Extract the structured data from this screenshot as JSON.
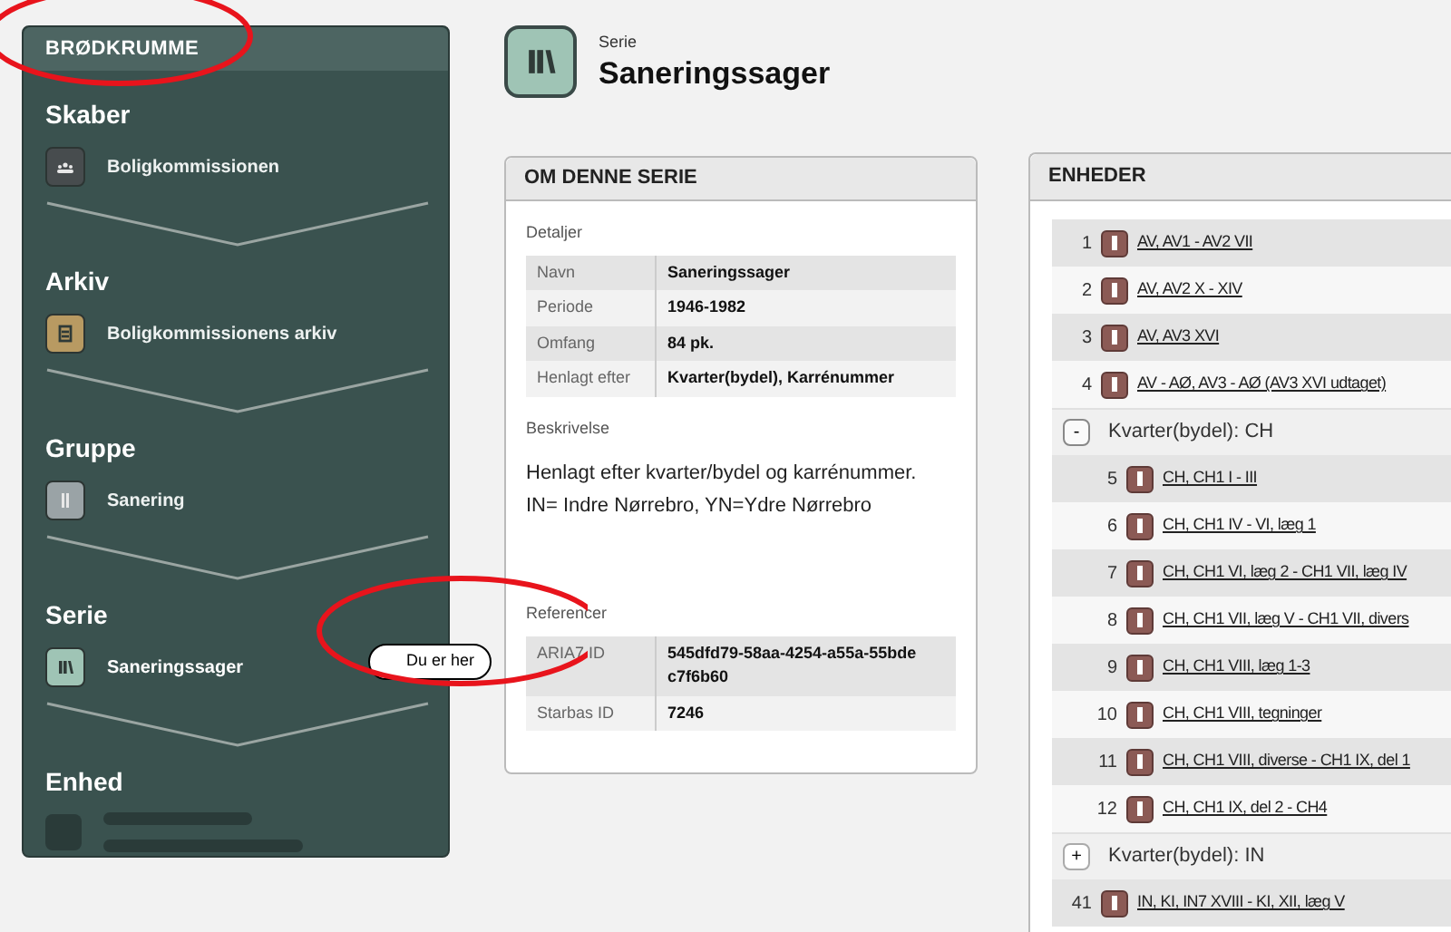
{
  "breadcrumb": {
    "title": "BRØDKRUMME",
    "levels": [
      {
        "kind": "creator",
        "label": "Skaber",
        "name": "Boligkommissionen",
        "current": false
      },
      {
        "kind": "archive",
        "label": "Arkiv",
        "name": "Boligkommissionens arkiv",
        "current": false
      },
      {
        "kind": "group",
        "label": "Gruppe",
        "name": "Sanering",
        "current": false
      },
      {
        "kind": "series",
        "label": "Serie",
        "name": "Saneringssager",
        "current": true
      },
      {
        "kind": "placeholder",
        "label": "Enhed",
        "current": false
      }
    ],
    "marker": "Du er her"
  },
  "header": {
    "kind": "series",
    "subtitle": "Serie",
    "title": "Saneringssager"
  },
  "about": {
    "title": "OM DENNE SERIE",
    "details_label": "Detaljer",
    "details": [
      {
        "label": "Navn",
        "value": "Saneringssager"
      },
      {
        "label": "Periode",
        "value": "1946-1982"
      },
      {
        "label": "Omfang",
        "value": "84 pk."
      },
      {
        "label": "Henlagt efter",
        "value": "Kvarter(bydel), Karrénummer"
      }
    ],
    "description_label": "Beskrivelse",
    "description": [
      "Henlagt efter kvarter/bydel og karrénummer.",
      "IN= Indre Nørrebro, YN=Ydre Nørrebro"
    ],
    "references_label": "Referencer",
    "references": [
      {
        "label": "ARIA7 ID",
        "value": "545dfd79-58aa-4254-a55a-55bdec7f6b60"
      },
      {
        "label": "Starbas ID",
        "value": "7246"
      }
    ]
  },
  "units": {
    "title": "ENHEDER",
    "rows": [
      {
        "kind": "unit",
        "number": "1",
        "title": "AV, AV1 - AV2 VII"
      },
      {
        "kind": "unit",
        "number": "2",
        "title": "AV, AV2 X - XIV"
      },
      {
        "kind": "unit",
        "number": "3",
        "title": "AV, AV3 XVI"
      },
      {
        "kind": "unit",
        "number": "4",
        "title": "AV - AØ, AV3 - AØ (AV3 XVI udtaget)"
      },
      {
        "kind": "group",
        "toggle": "-",
        "label": "Kvarter(bydel): CH",
        "expanded": true,
        "children": [
          {
            "kind": "unit",
            "number": "5",
            "title": "CH, CH1 I - III"
          },
          {
            "kind": "unit",
            "number": "6",
            "title": "CH, CH1 IV - VI, læg 1"
          },
          {
            "kind": "unit",
            "number": "7",
            "title": "CH, CH1 VI, læg 2 - CH1 VII, læg IV"
          },
          {
            "kind": "unit",
            "number": "8",
            "title": "CH, CH1 VII, læg V - CH1 VII, divers"
          },
          {
            "kind": "unit",
            "number": "9",
            "title": "CH, CH1 VIII, læg 1-3"
          },
          {
            "kind": "unit",
            "number": "10",
            "title": "CH, CH1 VIII, tegninger"
          },
          {
            "kind": "unit",
            "number": "11",
            "title": "CH, CH1 VIII, diverse - CH1 IX, del 1"
          },
          {
            "kind": "unit",
            "number": "12",
            "title": "CH, CH1 IX, del 2 - CH4"
          }
        ]
      },
      {
        "kind": "group",
        "toggle": "+",
        "label": "Kvarter(bydel): IN",
        "expanded": false,
        "children": []
      },
      {
        "kind": "unit",
        "number": "41",
        "title": "IN, KI, IN7 XVIII - KI, XII, læg V"
      }
    ]
  }
}
